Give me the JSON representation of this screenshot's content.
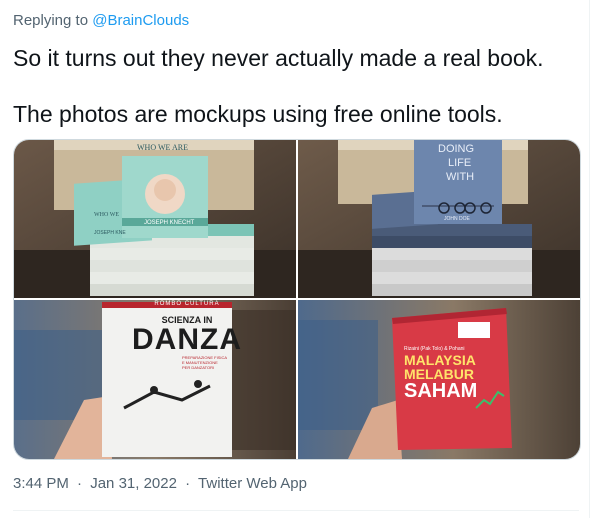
{
  "reply": {
    "prefix": "Replying to",
    "handle": "@BrainClouds"
  },
  "tweet": {
    "line1": "So it turns out they never actually made a real book.",
    "line2": "The photos are mockups using free online tools."
  },
  "photos": [
    {
      "cover_title": "WHO WE ARE",
      "author": "JOSEPH KNECHT",
      "spine_text": "WHO WE",
      "spine_author": "JOSEPH KNE"
    },
    {
      "cover_title_1": "DOING",
      "cover_title_2": "LIFE",
      "cover_title_3": "WITH",
      "author": "JOHN DOE"
    },
    {
      "publisher": "ROMBO CULTURA",
      "title_1": "SCIENZA IN",
      "title_2": "DANZA",
      "sub_1": "PREPARAZIONE FISICA",
      "sub_2": "E MANUTENZIONE",
      "sub_3": "PER DANZATORI"
    },
    {
      "authors": "Rizaini (Pak Tolo) & Pohani",
      "title_1": "MALAYSIA",
      "title_2": "MELABUR",
      "title_3": "SAHAM"
    }
  ],
  "meta": {
    "time": "3:44 PM",
    "date": "Jan 31, 2022",
    "app": "Twitter Web App",
    "separator": "·"
  },
  "colors": {
    "link": "#1d9bf0",
    "muted": "#536471",
    "text": "#0f1419"
  }
}
